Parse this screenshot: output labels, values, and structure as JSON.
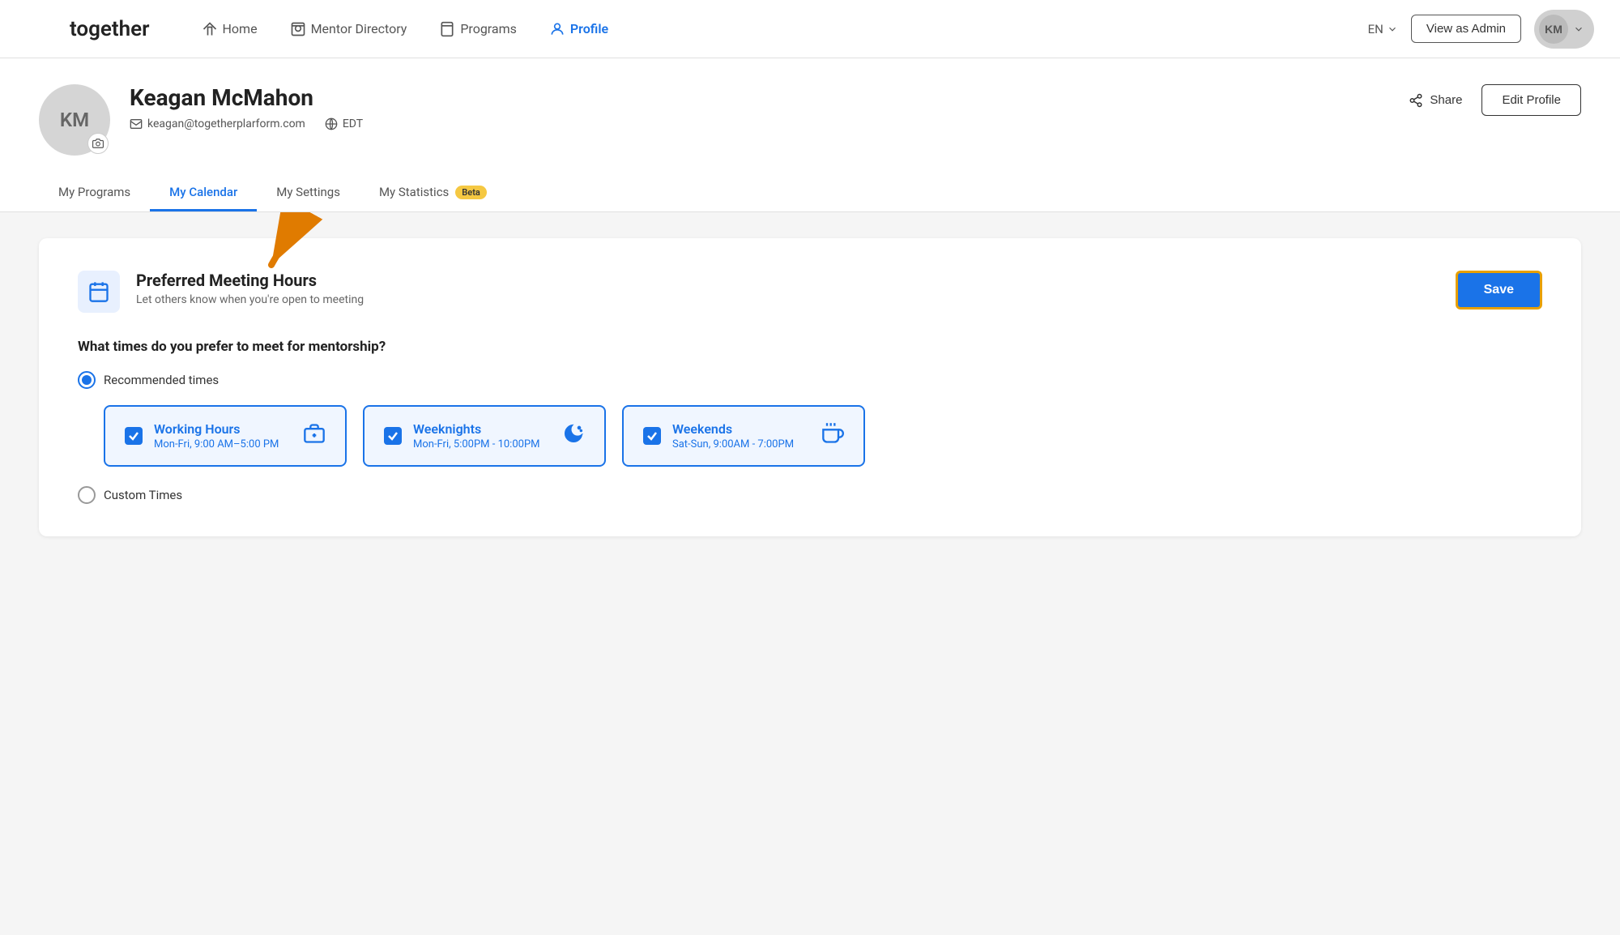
{
  "brand": {
    "name": "together"
  },
  "nav": {
    "items": [
      {
        "id": "home",
        "label": "Home",
        "icon": "home"
      },
      {
        "id": "mentor-directory",
        "label": "Mentor Directory",
        "icon": "search"
      },
      {
        "id": "programs",
        "label": "Programs",
        "icon": "bookmark"
      },
      {
        "id": "profile",
        "label": "Profile",
        "icon": "person",
        "active": true
      }
    ],
    "lang": "EN",
    "view_admin_label": "View as Admin",
    "avatar_initials": "KM"
  },
  "profile": {
    "avatar_initials": "KM",
    "name": "Keagan McMahon",
    "email": "keagan@togetherplarform.com",
    "timezone": "EDT",
    "share_label": "Share",
    "edit_profile_label": "Edit Profile"
  },
  "tabs": [
    {
      "id": "my-programs",
      "label": "My Programs",
      "active": false
    },
    {
      "id": "my-calendar",
      "label": "My Calendar",
      "active": true
    },
    {
      "id": "my-settings",
      "label": "My Settings",
      "active": false
    },
    {
      "id": "my-statistics",
      "label": "My Statistics",
      "active": false,
      "badge": "Beta"
    }
  ],
  "calendar": {
    "section_title": "Preferred Meeting Hours",
    "section_subtitle": "Let others know when you're open to meeting",
    "save_label": "Save",
    "question": "What times do you prefer to meet for mentorship?",
    "options": [
      {
        "id": "recommended",
        "label": "Recommended times",
        "selected": true
      },
      {
        "id": "custom",
        "label": "Custom Times",
        "selected": false
      }
    ],
    "time_slots": [
      {
        "id": "working-hours",
        "name": "Working Hours",
        "range": "Mon-Fri, 9:00 AM–5:00 PM",
        "checked": true,
        "icon": "briefcase"
      },
      {
        "id": "weeknights",
        "name": "Weeknights",
        "range": "Mon-Fri, 5:00PM - 10:00PM",
        "checked": true,
        "icon": "moon"
      },
      {
        "id": "weekends",
        "name": "Weekends",
        "range": "Sat-Sun, 9:00AM - 7:00PM",
        "checked": true,
        "icon": "coffee"
      }
    ]
  }
}
